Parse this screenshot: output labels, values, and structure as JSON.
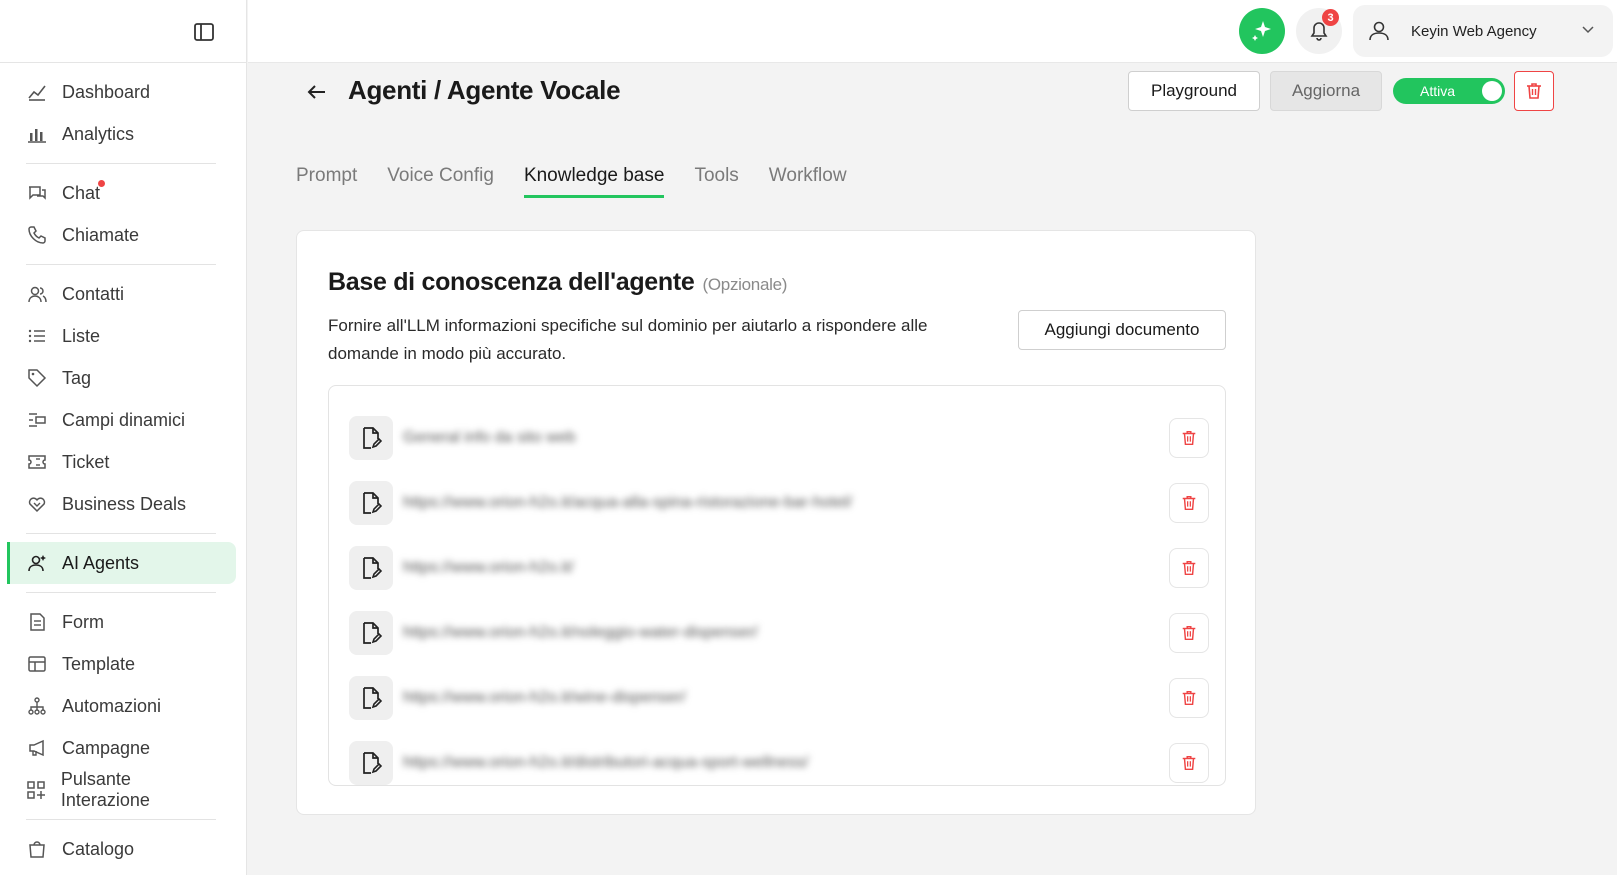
{
  "sidebar": {
    "groups": [
      [
        {
          "label": "Dashboard",
          "icon": "dashboard-icon"
        },
        {
          "label": "Analytics",
          "icon": "analytics-icon"
        }
      ],
      [
        {
          "label": "Chat",
          "icon": "chat-icon"
        },
        {
          "label": "Chiamate",
          "icon": "phone-icon"
        }
      ],
      [
        {
          "label": "Contatti",
          "icon": "contacts-icon"
        },
        {
          "label": "Liste",
          "icon": "list-icon"
        },
        {
          "label": "Tag",
          "icon": "tag-icon"
        },
        {
          "label": "Campi dinamici",
          "icon": "dynamic-fields-icon"
        },
        {
          "label": "Ticket",
          "icon": "ticket-icon"
        },
        {
          "label": "Business Deals",
          "icon": "handshake-icon"
        }
      ],
      [
        {
          "label": "AI Agents",
          "icon": "ai-agent-icon"
        }
      ],
      [
        {
          "label": "Form",
          "icon": "form-icon"
        },
        {
          "label": "Template",
          "icon": "template-icon"
        },
        {
          "label": "Automazioni",
          "icon": "automation-icon"
        },
        {
          "label": "Campagne",
          "icon": "megaphone-icon"
        },
        {
          "label": "Pulsante Interazione",
          "icon": "widget-icon"
        }
      ],
      [
        {
          "label": "Catalogo",
          "icon": "bag-icon"
        }
      ]
    ]
  },
  "topbar": {
    "notification_count": "3",
    "user_name": "Keyin Web Agency"
  },
  "header": {
    "title": "Agenti / Agente Vocale",
    "playground_label": "Playground",
    "update_label": "Aggiorna",
    "status_label": "Attiva"
  },
  "tabs": [
    {
      "label": "Prompt"
    },
    {
      "label": "Voice Config"
    },
    {
      "label": "Knowledge base"
    },
    {
      "label": "Tools"
    },
    {
      "label": "Workflow"
    }
  ],
  "active_tab": "Knowledge base",
  "card": {
    "title": "Base di conoscenza dell'agente",
    "optional": "(Opzionale)",
    "description": "Fornire all'LLM informazioni specifiche sul dominio per aiutarlo a rispondere alle domande in modo più accurato.",
    "add_button": "Aggiungi documento",
    "documents": [
      "General info da sito web",
      "https://www.orion-h2o.it/acqua-alla-spina-ristorazione-bar-hotel/",
      "https://www.orion-h2o.it/",
      "https://www.orion-h2o.it/noleggio-water-dispenser/",
      "https://www.orion-h2o.it/wine-dispenser/",
      "https://www.orion-h2o.it/distributori-acqua-sport-wellness/"
    ]
  },
  "colors": {
    "accent": "#22c55e",
    "danger": "#ef4444"
  }
}
